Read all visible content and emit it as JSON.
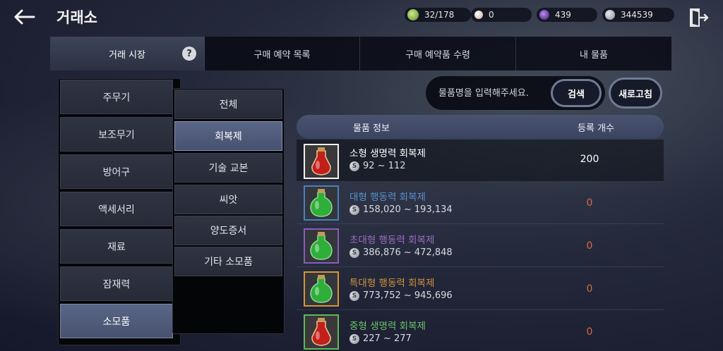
{
  "header": {
    "title": "거래소",
    "currencies": [
      {
        "icon": "energy-icon",
        "value": "32/178",
        "color": "#8fbf4a"
      },
      {
        "icon": "pearl-icon",
        "value": "0",
        "color": "#e6d8d2"
      },
      {
        "icon": "black-pearl-icon",
        "value": "439",
        "color": "#7a3fc0"
      },
      {
        "icon": "silver-coin-icon",
        "value": "344539",
        "color": "#b8bbc4"
      }
    ]
  },
  "tabs": [
    {
      "label": "거래 시장",
      "active": true
    },
    {
      "label": "구매 예약 목록",
      "active": false
    },
    {
      "label": "구매 예약품 수령",
      "active": false
    },
    {
      "label": "내 물품",
      "active": false
    }
  ],
  "categories": [
    {
      "label": "주무기",
      "active": false
    },
    {
      "label": "보조무기",
      "active": false
    },
    {
      "label": "방어구",
      "active": false
    },
    {
      "label": "액세서리",
      "active": false
    },
    {
      "label": "재료",
      "active": false
    },
    {
      "label": "잠재력",
      "active": false
    },
    {
      "label": "소모품",
      "active": true
    }
  ],
  "subcategories": [
    {
      "label": "전체",
      "active": false
    },
    {
      "label": "회복제",
      "active": true
    },
    {
      "label": "기술 교본",
      "active": false
    },
    {
      "label": "씨앗",
      "active": false
    },
    {
      "label": "양도증서",
      "active": false
    },
    {
      "label": "기타 소모품",
      "active": false
    }
  ],
  "search": {
    "placeholder": "물품명을 입력해주세요.",
    "button_label": "검색",
    "refresh_label": "새로고침"
  },
  "table": {
    "columns": [
      "물품 정보",
      "등록 개수"
    ],
    "rows": [
      {
        "name": "소형 생명력 회복제",
        "price": "92 ~ 112",
        "count": "200",
        "name_color": "#ffffff",
        "count_color": "#ffffff",
        "potion": "red",
        "frame": "#f0f0f0"
      },
      {
        "name": "대형 행동력 회복제",
        "price": "158,020 ~ 193,134",
        "count": "0",
        "name_color": "#5a8fd0",
        "count_color": "#d86a4a",
        "potion": "green",
        "frame": "#4a7fc0"
      },
      {
        "name": "초대형 행동력 회복제",
        "price": "386,876 ~ 472,848",
        "count": "0",
        "name_color": "#9a6cc6",
        "count_color": "#d86a4a",
        "potion": "green",
        "frame": "#8a5bbd"
      },
      {
        "name": "특대형 행동력 회복제",
        "price": "773,752 ~ 945,696",
        "count": "0",
        "name_color": "#d0943c",
        "count_color": "#d86a4a",
        "potion": "green",
        "frame": "#d6933a"
      },
      {
        "name": "중형 생명력 회복제",
        "price": "227 ~ 277",
        "count": "0",
        "name_color": "#6dc26a",
        "count_color": "#d86a4a",
        "potion": "red",
        "frame": "#5db85a"
      }
    ]
  }
}
